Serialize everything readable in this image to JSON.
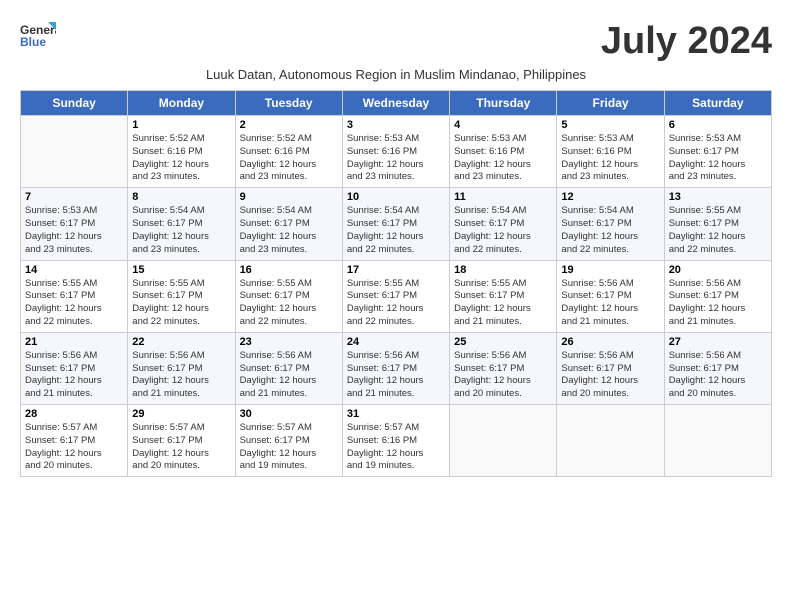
{
  "header": {
    "logo_line1": "General",
    "logo_line2": "Blue",
    "month_year": "July 2024",
    "subtitle": "Luuk Datan, Autonomous Region in Muslim Mindanao, Philippines"
  },
  "columns": [
    "Sunday",
    "Monday",
    "Tuesday",
    "Wednesday",
    "Thursday",
    "Friday",
    "Saturday"
  ],
  "weeks": [
    {
      "bg": "white",
      "days": [
        {
          "num": "",
          "info": ""
        },
        {
          "num": "1",
          "info": "Sunrise: 5:52 AM\nSunset: 6:16 PM\nDaylight: 12 hours\nand 23 minutes."
        },
        {
          "num": "2",
          "info": "Sunrise: 5:52 AM\nSunset: 6:16 PM\nDaylight: 12 hours\nand 23 minutes."
        },
        {
          "num": "3",
          "info": "Sunrise: 5:53 AM\nSunset: 6:16 PM\nDaylight: 12 hours\nand 23 minutes."
        },
        {
          "num": "4",
          "info": "Sunrise: 5:53 AM\nSunset: 6:16 PM\nDaylight: 12 hours\nand 23 minutes."
        },
        {
          "num": "5",
          "info": "Sunrise: 5:53 AM\nSunset: 6:16 PM\nDaylight: 12 hours\nand 23 minutes."
        },
        {
          "num": "6",
          "info": "Sunrise: 5:53 AM\nSunset: 6:17 PM\nDaylight: 12 hours\nand 23 minutes."
        }
      ]
    },
    {
      "bg": "light",
      "days": [
        {
          "num": "7",
          "info": "Sunrise: 5:53 AM\nSunset: 6:17 PM\nDaylight: 12 hours\nand 23 minutes."
        },
        {
          "num": "8",
          "info": "Sunrise: 5:54 AM\nSunset: 6:17 PM\nDaylight: 12 hours\nand 23 minutes."
        },
        {
          "num": "9",
          "info": "Sunrise: 5:54 AM\nSunset: 6:17 PM\nDaylight: 12 hours\nand 23 minutes."
        },
        {
          "num": "10",
          "info": "Sunrise: 5:54 AM\nSunset: 6:17 PM\nDaylight: 12 hours\nand 22 minutes."
        },
        {
          "num": "11",
          "info": "Sunrise: 5:54 AM\nSunset: 6:17 PM\nDaylight: 12 hours\nand 22 minutes."
        },
        {
          "num": "12",
          "info": "Sunrise: 5:54 AM\nSunset: 6:17 PM\nDaylight: 12 hours\nand 22 minutes."
        },
        {
          "num": "13",
          "info": "Sunrise: 5:55 AM\nSunset: 6:17 PM\nDaylight: 12 hours\nand 22 minutes."
        }
      ]
    },
    {
      "bg": "white",
      "days": [
        {
          "num": "14",
          "info": "Sunrise: 5:55 AM\nSunset: 6:17 PM\nDaylight: 12 hours\nand 22 minutes."
        },
        {
          "num": "15",
          "info": "Sunrise: 5:55 AM\nSunset: 6:17 PM\nDaylight: 12 hours\nand 22 minutes."
        },
        {
          "num": "16",
          "info": "Sunrise: 5:55 AM\nSunset: 6:17 PM\nDaylight: 12 hours\nand 22 minutes."
        },
        {
          "num": "17",
          "info": "Sunrise: 5:55 AM\nSunset: 6:17 PM\nDaylight: 12 hours\nand 22 minutes."
        },
        {
          "num": "18",
          "info": "Sunrise: 5:55 AM\nSunset: 6:17 PM\nDaylight: 12 hours\nand 21 minutes."
        },
        {
          "num": "19",
          "info": "Sunrise: 5:56 AM\nSunset: 6:17 PM\nDaylight: 12 hours\nand 21 minutes."
        },
        {
          "num": "20",
          "info": "Sunrise: 5:56 AM\nSunset: 6:17 PM\nDaylight: 12 hours\nand 21 minutes."
        }
      ]
    },
    {
      "bg": "light",
      "days": [
        {
          "num": "21",
          "info": "Sunrise: 5:56 AM\nSunset: 6:17 PM\nDaylight: 12 hours\nand 21 minutes."
        },
        {
          "num": "22",
          "info": "Sunrise: 5:56 AM\nSunset: 6:17 PM\nDaylight: 12 hours\nand 21 minutes."
        },
        {
          "num": "23",
          "info": "Sunrise: 5:56 AM\nSunset: 6:17 PM\nDaylight: 12 hours\nand 21 minutes."
        },
        {
          "num": "24",
          "info": "Sunrise: 5:56 AM\nSunset: 6:17 PM\nDaylight: 12 hours\nand 21 minutes."
        },
        {
          "num": "25",
          "info": "Sunrise: 5:56 AM\nSunset: 6:17 PM\nDaylight: 12 hours\nand 20 minutes."
        },
        {
          "num": "26",
          "info": "Sunrise: 5:56 AM\nSunset: 6:17 PM\nDaylight: 12 hours\nand 20 minutes."
        },
        {
          "num": "27",
          "info": "Sunrise: 5:56 AM\nSunset: 6:17 PM\nDaylight: 12 hours\nand 20 minutes."
        }
      ]
    },
    {
      "bg": "white",
      "days": [
        {
          "num": "28",
          "info": "Sunrise: 5:57 AM\nSunset: 6:17 PM\nDaylight: 12 hours\nand 20 minutes."
        },
        {
          "num": "29",
          "info": "Sunrise: 5:57 AM\nSunset: 6:17 PM\nDaylight: 12 hours\nand 20 minutes."
        },
        {
          "num": "30",
          "info": "Sunrise: 5:57 AM\nSunset: 6:17 PM\nDaylight: 12 hours\nand 19 minutes."
        },
        {
          "num": "31",
          "info": "Sunrise: 5:57 AM\nSunset: 6:16 PM\nDaylight: 12 hours\nand 19 minutes."
        },
        {
          "num": "",
          "info": ""
        },
        {
          "num": "",
          "info": ""
        },
        {
          "num": "",
          "info": ""
        }
      ]
    }
  ]
}
